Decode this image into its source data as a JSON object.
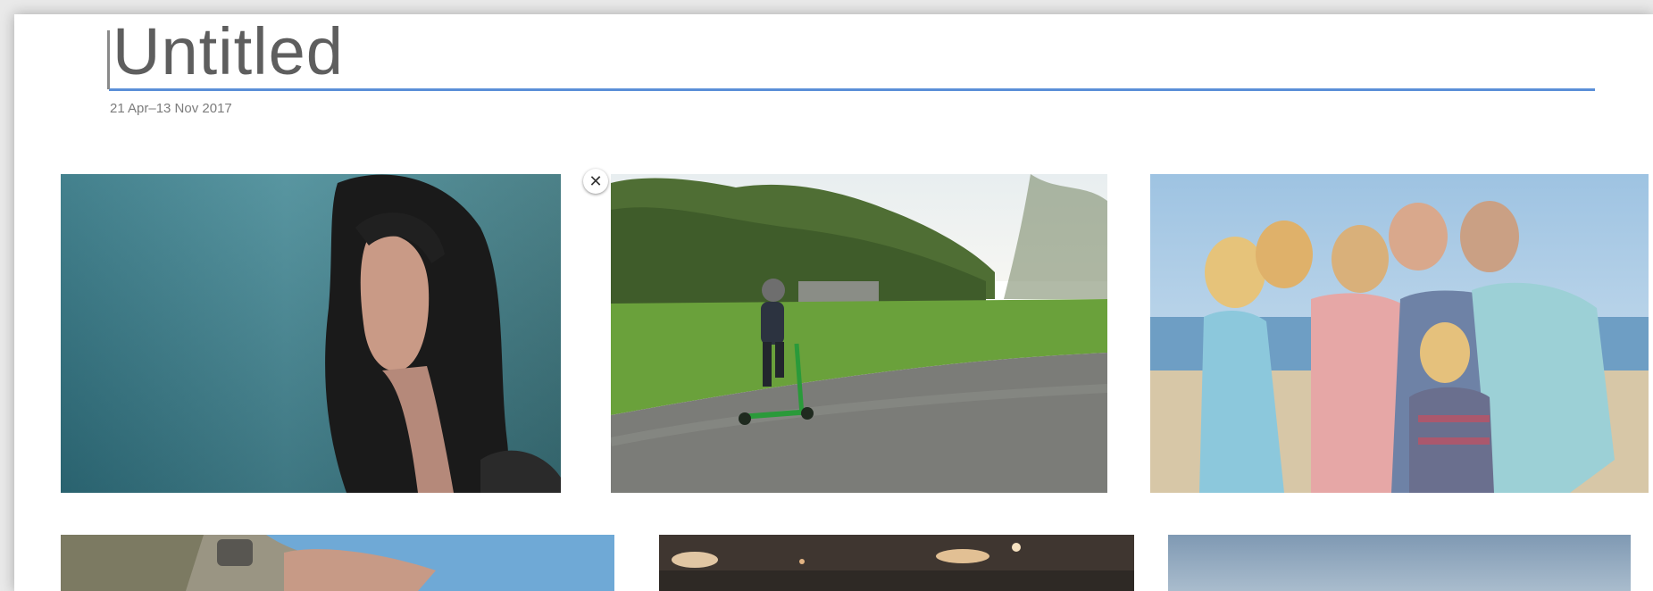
{
  "album": {
    "title": "Untitled",
    "date_range": "21 Apr–13 Nov 2017"
  },
  "photo_grid": {
    "remove_icon": "close-icon",
    "remove_glyph": "✕",
    "row1": [
      {
        "subject": "woman-portrait-by-water"
      },
      {
        "subject": "child-on-scooter-in-park"
      },
      {
        "subject": "family-on-beach"
      }
    ],
    "row2": [
      {
        "subject": "hands-on-rocks"
      },
      {
        "subject": "city-lights-at-night"
      },
      {
        "subject": "sky-and-sea"
      }
    ]
  }
}
